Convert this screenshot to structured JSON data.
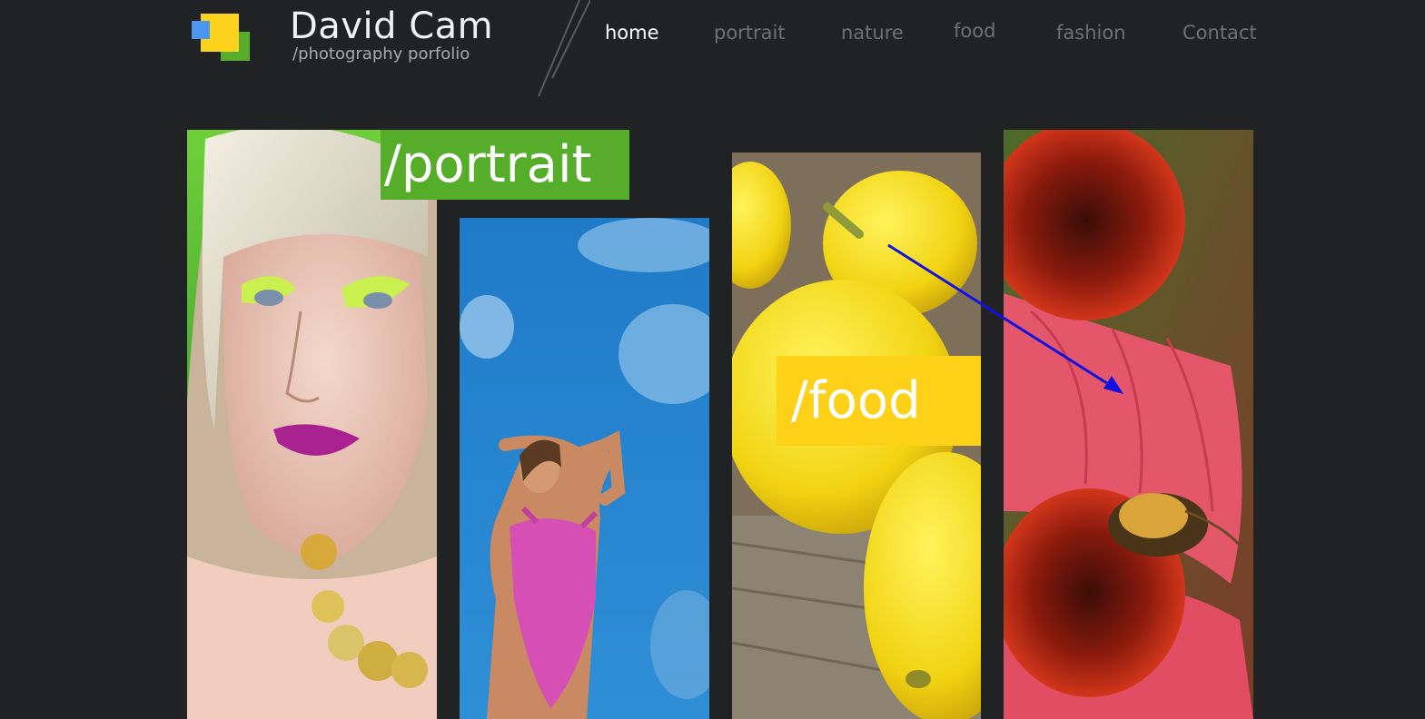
{
  "brand": {
    "name": "David Cam",
    "tagline": "/photography porfolio",
    "logo_icon": "stacked-squares-logo-icon"
  },
  "nav": {
    "items": [
      {
        "label": "home",
        "active": true
      },
      {
        "label": "portrait",
        "active": false
      },
      {
        "label": "nature",
        "active": false
      },
      {
        "label": "food",
        "active": false
      },
      {
        "label": "fashion",
        "active": false
      },
      {
        "label": "Contact",
        "active": false
      }
    ]
  },
  "gallery": {
    "tiles": [
      {
        "subject": "portrait photo of woman with green eyeshadow"
      },
      {
        "subject": "woman in pink swimsuit against blue sky"
      },
      {
        "subject": "lemons on wooden table"
      },
      {
        "subject": "pink coneflowers with bumblebee"
      }
    ],
    "labels": {
      "portrait": "/portrait",
      "food": "/food"
    }
  },
  "colors": {
    "background": "#212224",
    "accent_green": "#56ad2a",
    "accent_yellow": "#fdd118",
    "accent_blue": "#4c97ee",
    "nav_active": "#ffffff",
    "nav_inactive": "#6f7073",
    "annotation_arrow": "#1010e0"
  }
}
